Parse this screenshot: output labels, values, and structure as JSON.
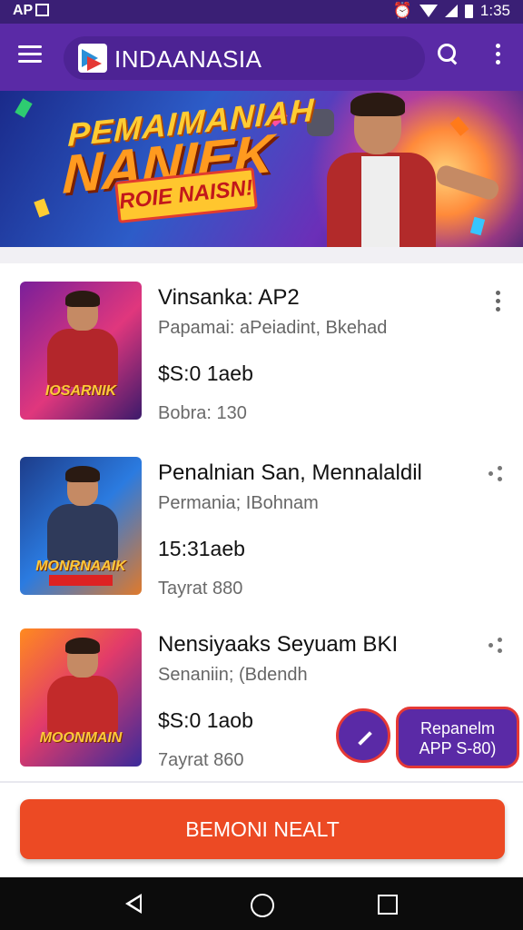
{
  "status_bar": {
    "left_text": "AP",
    "time": "1:35"
  },
  "app_bar": {
    "title": "INDAANASIA"
  },
  "banner": {
    "line1": "PEMAIMANIAH",
    "line2": "NANIEK",
    "tag": "ROIE NAISN!"
  },
  "cards": [
    {
      "title": "Vinsanka: AP2",
      "subtitle": "Papamai: aPeiadint, Bkehad",
      "price": "$S:0 1aeb",
      "meta": "Bobra: 130",
      "thumb_label": "IOSARNIK",
      "action_icon": "kebab-icon"
    },
    {
      "title": "Penalnian San, Mennalaldil",
      "subtitle": "Permania; IBohnam",
      "price": "15:31aeb",
      "meta": "Tayrat 880",
      "thumb_label": "MONRNAAIK",
      "action_icon": "share-icon"
    },
    {
      "title": "Nensiyaaks Seyuam BKI",
      "subtitle": "Senaniin; (Bdendh",
      "price": "$S:0 1aob",
      "meta": "7ayrat 860",
      "thumb_label": "MOONMAIN",
      "action_icon": "share-icon"
    }
  ],
  "fab": {
    "icon": "pencil-icon"
  },
  "promo": {
    "line1": "Repanelm",
    "line2": "APP S-80)"
  },
  "cta": {
    "label": "BEMONI NEALT"
  },
  "colors": {
    "primary": "#5a2aa6",
    "status": "#3a1f75",
    "accent": "#ec4a24"
  }
}
